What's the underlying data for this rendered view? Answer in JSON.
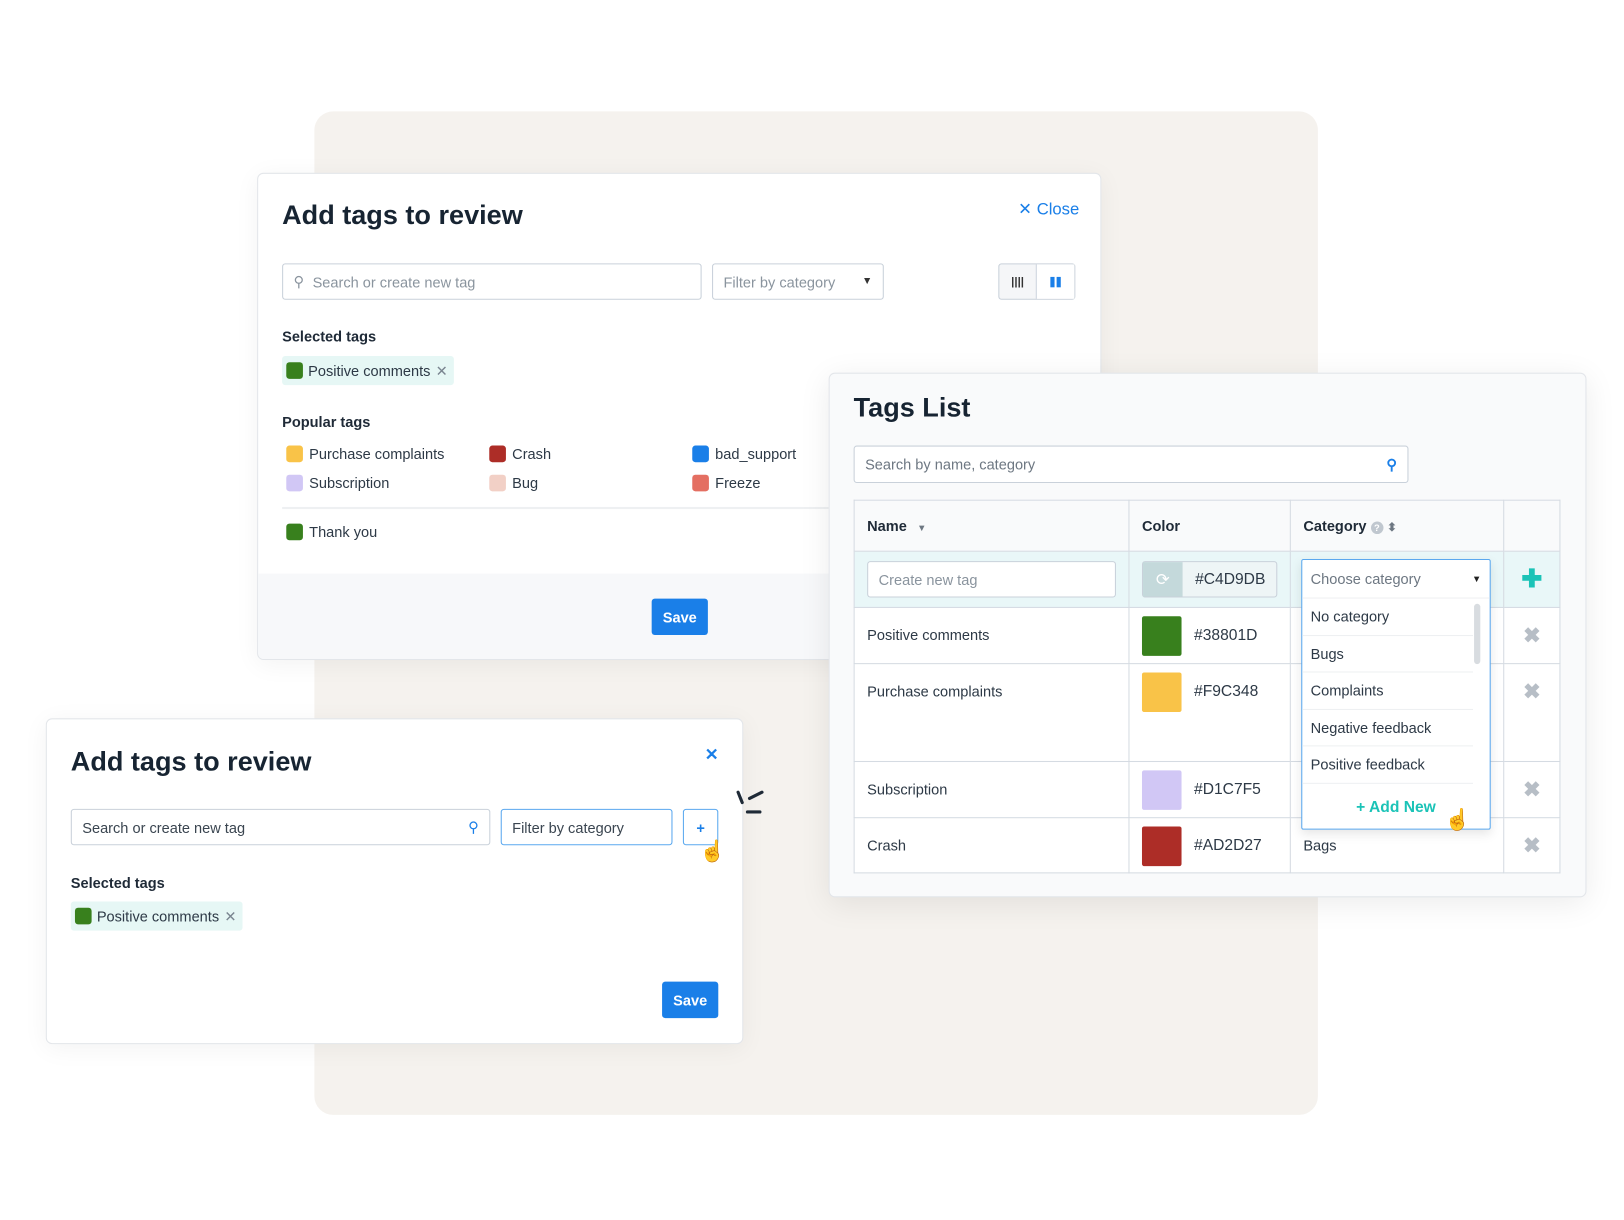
{
  "review_large": {
    "title": "Add tags to review",
    "close_label": "Close",
    "search_placeholder": "Search or create new tag",
    "filter_placeholder": "Filter by category",
    "selected_label": "Selected tags",
    "selected_tag": {
      "name": "Positive comments",
      "color": "#38801D"
    },
    "popular_label": "Popular tags",
    "popular": [
      {
        "name": "Purchase complaints",
        "color": "#F9C348"
      },
      {
        "name": "Crash",
        "color": "#AD2D27"
      },
      {
        "name": "bad_support",
        "color": "#1A7FE8"
      },
      {
        "name": "Subscription",
        "color": "#D1C7F5"
      },
      {
        "name": "Bug",
        "color": "#F2D0C6"
      },
      {
        "name": "Freeze",
        "color": "#E46F62"
      }
    ],
    "extra_tag": {
      "name": "Thank you",
      "color": "#38801D"
    },
    "save_label": "Save"
  },
  "review_small": {
    "title": "Add tags to review",
    "search_placeholder": "Search or create new tag",
    "filter_placeholder": "Filter by category",
    "add_label": "+",
    "selected_label": "Selected tags",
    "selected_tag": {
      "name": "Positive comments",
      "color": "#38801D"
    },
    "save_label": "Save"
  },
  "tags_list": {
    "title": "Tags List",
    "search_placeholder": "Search by name, category",
    "headers": {
      "name": "Name",
      "color": "Color",
      "category": "Category"
    },
    "new_row": {
      "name_placeholder": "Create new tag",
      "color": "#C4D9DB",
      "category_placeholder": "Choose category"
    },
    "rows": [
      {
        "name": "Positive comments",
        "color": "#38801D",
        "category": ""
      },
      {
        "name": "Purchase complaints",
        "color": "#F9C348",
        "category": ""
      },
      {
        "name": "Subscription",
        "color": "#D1C7F5",
        "category": ""
      },
      {
        "name": "Crash",
        "color": "#AD2D27",
        "category": "Bags"
      }
    ],
    "dropdown": {
      "options": [
        "No category",
        "Bugs",
        "Complaints",
        "Negative feedback",
        "Positive feedback"
      ],
      "add_new": "+ Add New"
    }
  },
  "colors": {
    "accent": "#1A7FE8",
    "teal": "#1BC3B7"
  }
}
